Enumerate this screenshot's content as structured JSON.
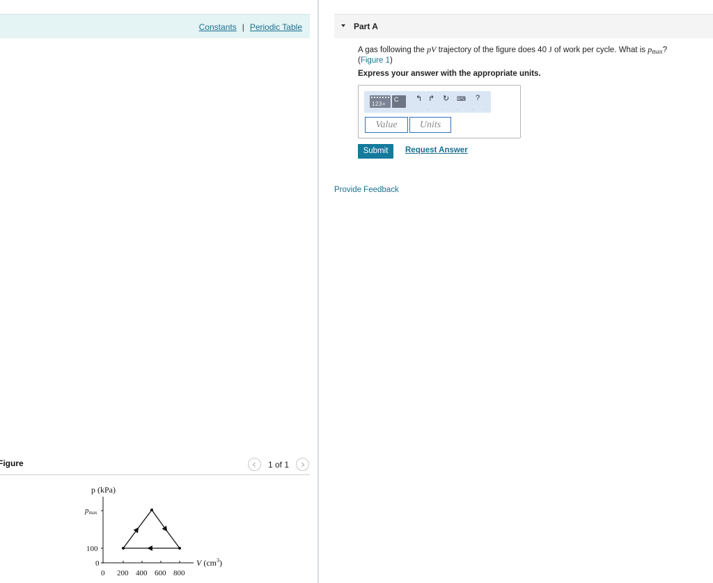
{
  "top_links": {
    "constants": "Constants",
    "separator": "|",
    "periodic_table": "Periodic Table"
  },
  "figure_panel": {
    "title": "Figure",
    "pager_text": "1 of 1",
    "prev_icon": "chevron-left-icon",
    "next_icon": "chevron-right-icon"
  },
  "graph": {
    "y_axis_label": "p (kPa)",
    "y_tick_pmax": "pmax",
    "y_tick_100": "100",
    "y_tick_0": "0",
    "x_axis_label": "V (cm",
    "x_axis_label_sup": "3",
    "x_axis_label_end": ")",
    "x_ticks": [
      "0",
      "200",
      "400",
      "600",
      "800"
    ]
  },
  "part": {
    "caret_icon": "caret-down-icon",
    "title": "Part A"
  },
  "question": {
    "text_1": "A gas following the ",
    "pV": "pV",
    "text_2": " trajectory of the figure does 40 ",
    "unit_J": "J",
    "text_3": " of work per cycle. What is ",
    "pmax_p": "p",
    "pmax_sub": "max",
    "text_4": "?",
    "figure_link_open": "(",
    "figure_link": "Figure 1",
    "figure_link_close": ")"
  },
  "instruction": "Express your answer with the appropriate units.",
  "toolbar": {
    "templates_label": "123+",
    "square_label": "C",
    "undo_icon": "undo-icon",
    "redo_icon": "redo-icon",
    "reset_icon": "reset-icon",
    "keyboard_icon": "keyboard-icon",
    "help_label": "?"
  },
  "inputs": {
    "value_placeholder": "Value",
    "units_placeholder": "Units"
  },
  "actions": {
    "submit": "Submit",
    "request_answer": "Request Answer"
  },
  "feedback": "Provide Feedback",
  "colors": {
    "accent": "#157a9c",
    "link": "#1a6f8f",
    "header_bg": "#e4f3f4",
    "toolbar_bg": "#dbe6f5"
  }
}
